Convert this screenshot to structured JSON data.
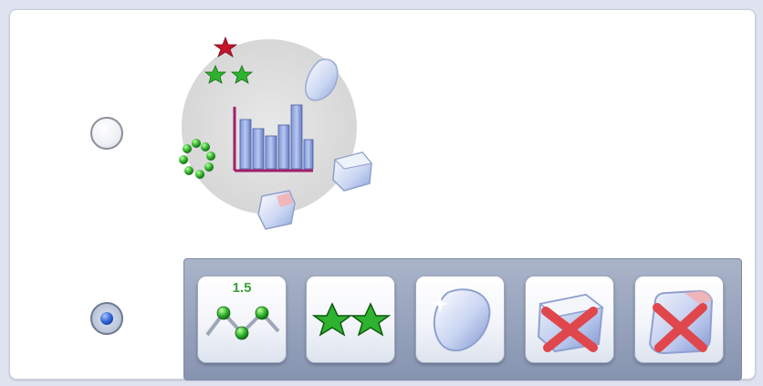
{
  "chart_options": {
    "option_icon": {
      "icon": "chart-with-accessories-icon",
      "selected": false
    },
    "option_toolbar": {
      "selected": true,
      "buttons": [
        {
          "name": "line-markers-tool-button",
          "icon": "line-with-markers-icon",
          "label": "1.5"
        },
        {
          "name": "stars-tool-button",
          "icon": "green-stars-icon"
        },
        {
          "name": "glass-shape-tool-button",
          "icon": "glass-shape-icon"
        },
        {
          "name": "cube-delete-tool-button",
          "icon": "cube-with-red-x-icon"
        },
        {
          "name": "rounded-cube-delete-tool-button",
          "icon": "rounded-cube-with-red-x-icon"
        }
      ]
    }
  },
  "colors": {
    "panel_bg": "#ffffff",
    "toolbar_bg": "#98a4bd",
    "green": "#2fb22f",
    "red_x": "#e0474c",
    "glass_blue": "#b9c8ec"
  }
}
